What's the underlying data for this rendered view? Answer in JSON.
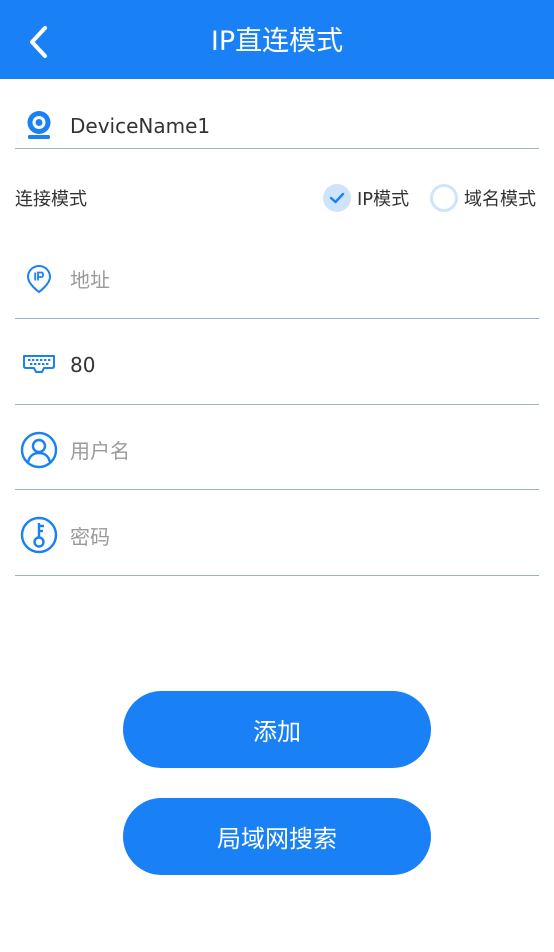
{
  "header": {
    "title": "IP直连模式",
    "background": "#1A80F5",
    "back_icon": "chevron-left-icon"
  },
  "device": {
    "icon": "camera-icon",
    "name": "DeviceName1"
  },
  "connection_mode": {
    "label": "连接模式",
    "options": [
      {
        "label": "IP模式",
        "checked": true
      },
      {
        "label": "域名模式",
        "checked": false
      }
    ]
  },
  "fields": {
    "address": {
      "icon": "ip-location-icon",
      "placeholder": "地址",
      "value": ""
    },
    "port": {
      "icon": "keyboard-port-icon",
      "placeholder": "",
      "value": "80"
    },
    "username": {
      "icon": "user-icon",
      "placeholder": "用户名",
      "value": ""
    },
    "password": {
      "icon": "key-icon",
      "placeholder": "密码",
      "value": ""
    }
  },
  "buttons": {
    "add_label": "添加",
    "lan_search_label": "局域网搜索"
  },
  "colors": {
    "accent": "#1A80F5",
    "divider": "#9EB4C6",
    "radio_fill": "#CFE4FA"
  }
}
